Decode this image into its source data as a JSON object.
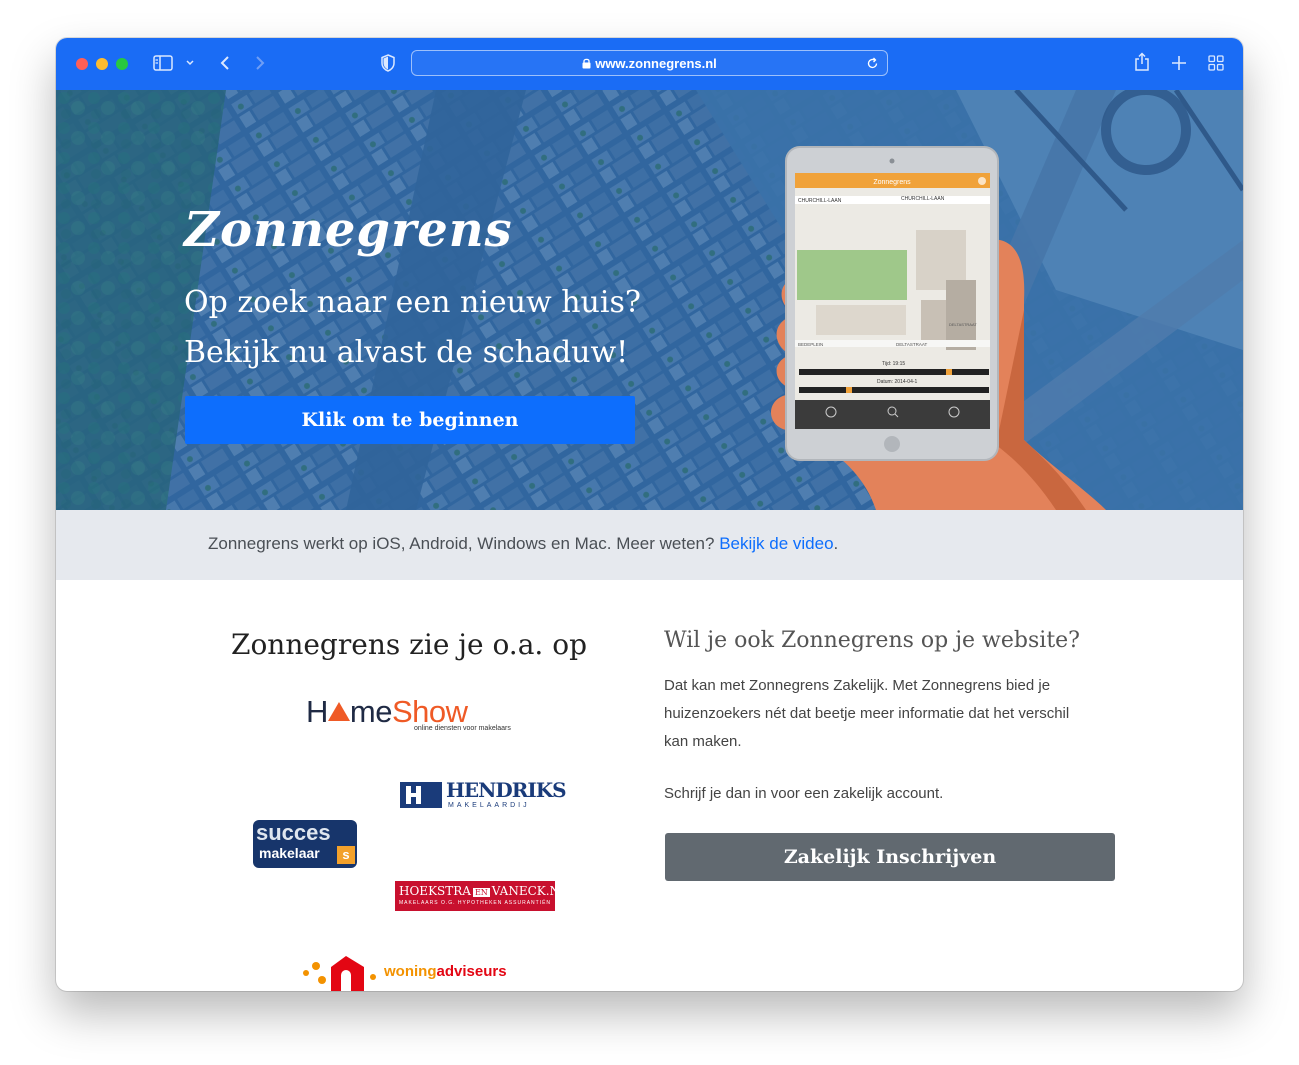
{
  "browser": {
    "url": "www.zonnegrens.nl",
    "colors": {
      "toolbar": "#1a6cf5",
      "close": "#ff5f57",
      "minimize": "#febc2e",
      "zoom": "#28c840"
    }
  },
  "hero": {
    "brand": "Zonnegrens",
    "tagline_line1": "Op zoek naar een nieuw huis?",
    "tagline_line2": "Bekijk nu alvast de schaduw!",
    "cta_label": "Klik om te beginnen",
    "tablet": {
      "app_title": "Zonnegrens",
      "street1": "CHURCHILL-LAAN",
      "street2": "CHURCHILL-LAAN",
      "street3": "DELTASTRAAT",
      "street4": "DELTASTRAAT",
      "street5": "BEDEPLEIN",
      "time_label": "Tijd: 19:15",
      "date_label": "Datum: 2014-04-1"
    }
  },
  "strip": {
    "text": "Zonnegrens werkt op iOS, Android, Windows en Mac. Meer weten? ",
    "link": "Bekijk de video",
    "after": "."
  },
  "partners": {
    "title": "Zonnegrens zie je o.a. op",
    "homeshow": {
      "h": "H",
      "me": "me",
      "show": "Show",
      "sub": "online diensten voor makelaars"
    },
    "hendriks": {
      "name": "HENDRIKS",
      "sub": "MAKELAARDIJ"
    },
    "succes": {
      "line1": "succes",
      "line2": "makelaar",
      "s": "s"
    },
    "hoekstra": {
      "a": "HOEKSTRA",
      "en": "EN",
      "b": "VANECK.NL",
      "sub": "MAKELAARS O.G.  HYPOTHEKEN  ASSURANTIËN"
    },
    "woning": {
      "a": "woning",
      "b": "adviseurs"
    }
  },
  "business": {
    "title": "Wil je ook Zonnegrens op je website?",
    "line1": "Dat kan met Zonnegrens Zakelijk. Met Zonnegrens bied je",
    "line2": "huizenzoekers nét dat beetje meer informatie dat het verschil",
    "line3": "kan maken.",
    "line4": "Schrijf je dan in voor een zakelijk account.",
    "button": "Zakelijk Inschrijven"
  }
}
